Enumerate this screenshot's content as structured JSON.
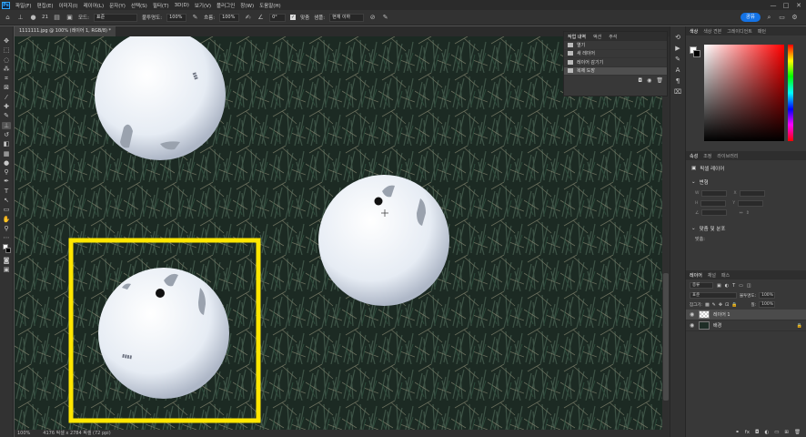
{
  "menubar": {
    "logo": "Ps",
    "items": [
      "파일(F)",
      "편집(E)",
      "이미지(I)",
      "레이어(L)",
      "문자(Y)",
      "선택(S)",
      "필터(T)",
      "3D(D)",
      "보기(V)",
      "플러그인",
      "창(W)",
      "도움말(H)"
    ],
    "window_controls": [
      "—",
      "□",
      "✕"
    ]
  },
  "options_bar": {
    "brush_size": "21",
    "mode_label": "모드:",
    "mode_value": "표준",
    "opacity_label": "불투명도:",
    "opacity_value": "100%",
    "flow_label": "흐름:",
    "flow_value": "100%",
    "angle_value": "0°",
    "align_label": "맞춤",
    "sample_label": "샘플:",
    "sample_value": "현재 이하",
    "share_label": "공유"
  },
  "document": {
    "tab_title": "1111111.jpg @ 100% (레이어 1, RGB/8) *",
    "zoom": "100%",
    "doc_size": "4176 픽셀 x 2784 픽셀 (72 ppi)"
  },
  "history_panel": {
    "tabs": [
      "작업 내역",
      "액션",
      "주석"
    ],
    "items": [
      "열기",
      "새 레이어",
      "레이어 감기기",
      "복제 도장"
    ],
    "selected_index": 3
  },
  "color_panel": {
    "tabs": [
      "색상",
      "색상 견본",
      "그레이디언트",
      "패턴"
    ],
    "hue_color": "#ff0000"
  },
  "properties_panel": {
    "tabs": [
      "속성",
      "조정",
      "라이브러리"
    ],
    "layer_type": "픽셀 레이어",
    "transform_header": "변형",
    "transform_labels": [
      "W",
      "H",
      "X",
      "Y"
    ],
    "align_header": "맞춤 및 분포",
    "align_sub": "맞춤:"
  },
  "layers_panel": {
    "tabs": [
      "레이어",
      "채널",
      "패스"
    ],
    "filter_value": "종류",
    "blend_mode": "표준",
    "opacity_label": "불투명도:",
    "opacity_value": "100%",
    "lock_label": "잠그기:",
    "fill_label": "칠:",
    "fill_value": "100%",
    "layers": [
      {
        "name": "레이어 1",
        "selected": true
      },
      {
        "name": "배경",
        "selected": false
      }
    ]
  }
}
